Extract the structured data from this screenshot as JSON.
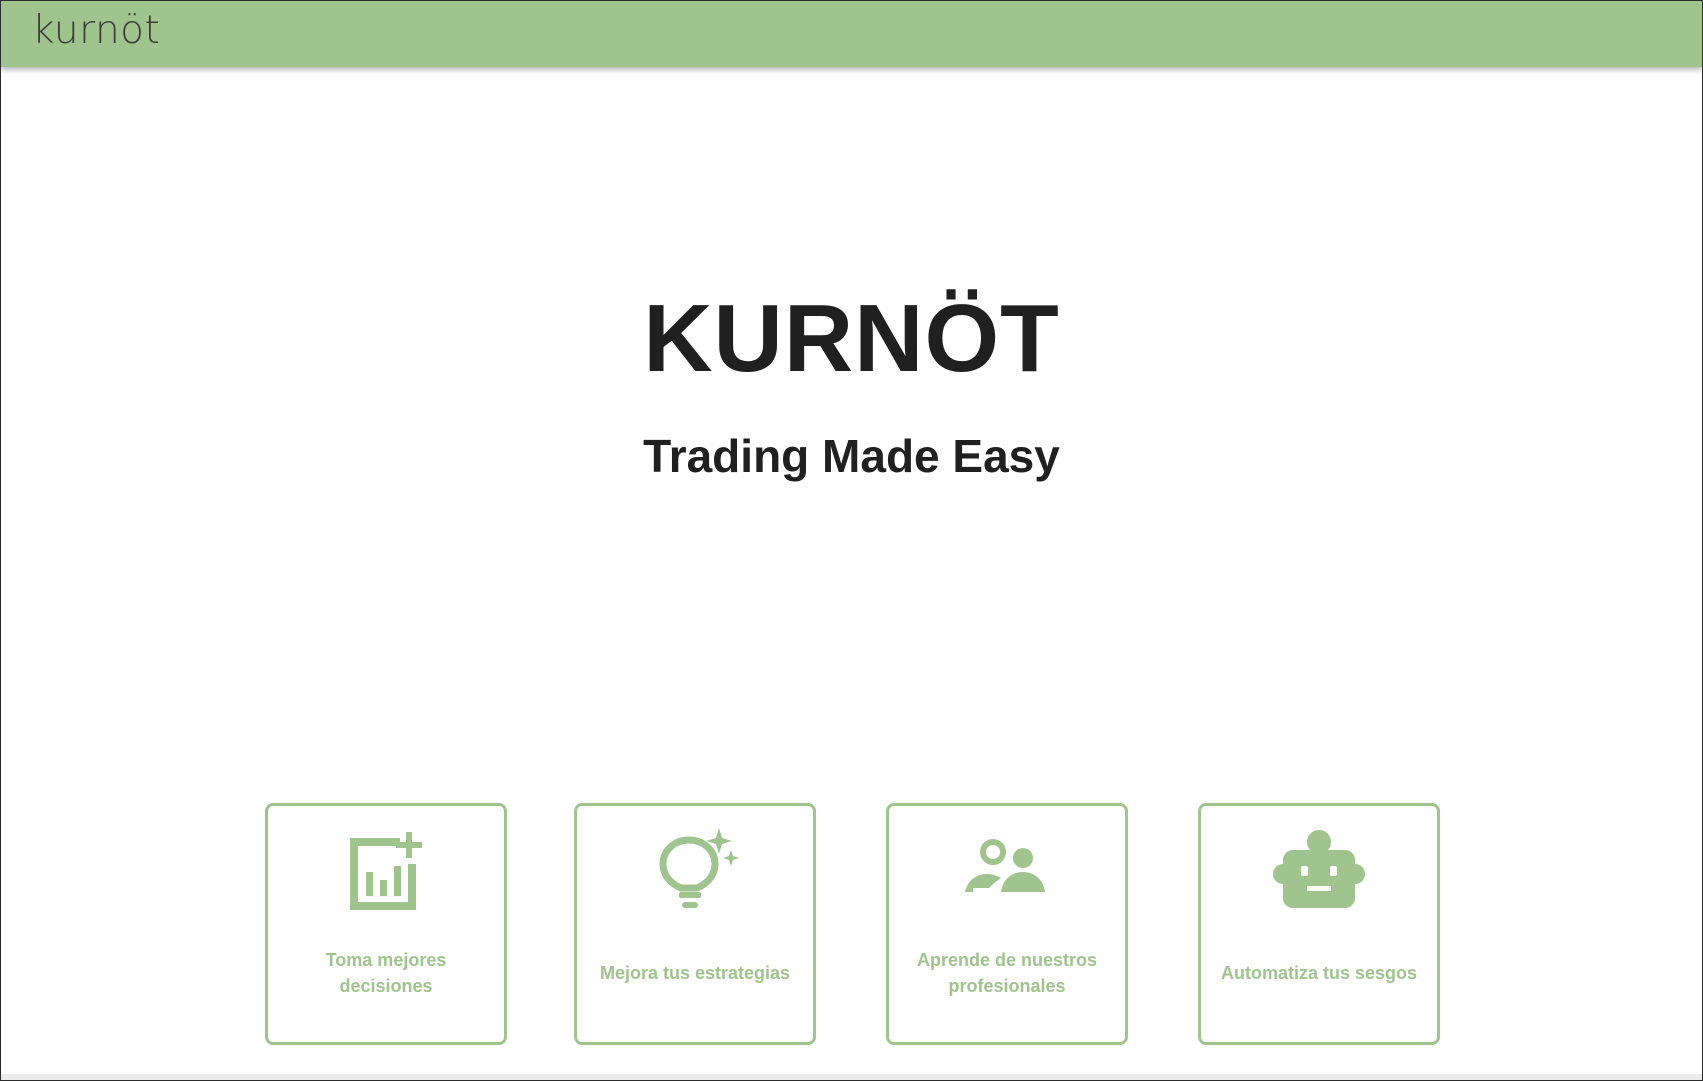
{
  "header": {
    "logo_text": "kurnöt"
  },
  "hero": {
    "title": "KURNÖT",
    "subtitle": "Trading Made Easy"
  },
  "features": [
    {
      "label": "Toma mejores decisiones",
      "icon": "add-chart-icon"
    },
    {
      "label": "Mejora tus estrategias",
      "icon": "lightbulb-sparkle-icon"
    },
    {
      "label": "Aprende de nuestros profesionales",
      "icon": "people-icon"
    },
    {
      "label": "Automatiza tus sesgos",
      "icon": "robot-icon"
    }
  ],
  "colors": {
    "accent": "#9fc48d",
    "text_dark": "#202020"
  }
}
